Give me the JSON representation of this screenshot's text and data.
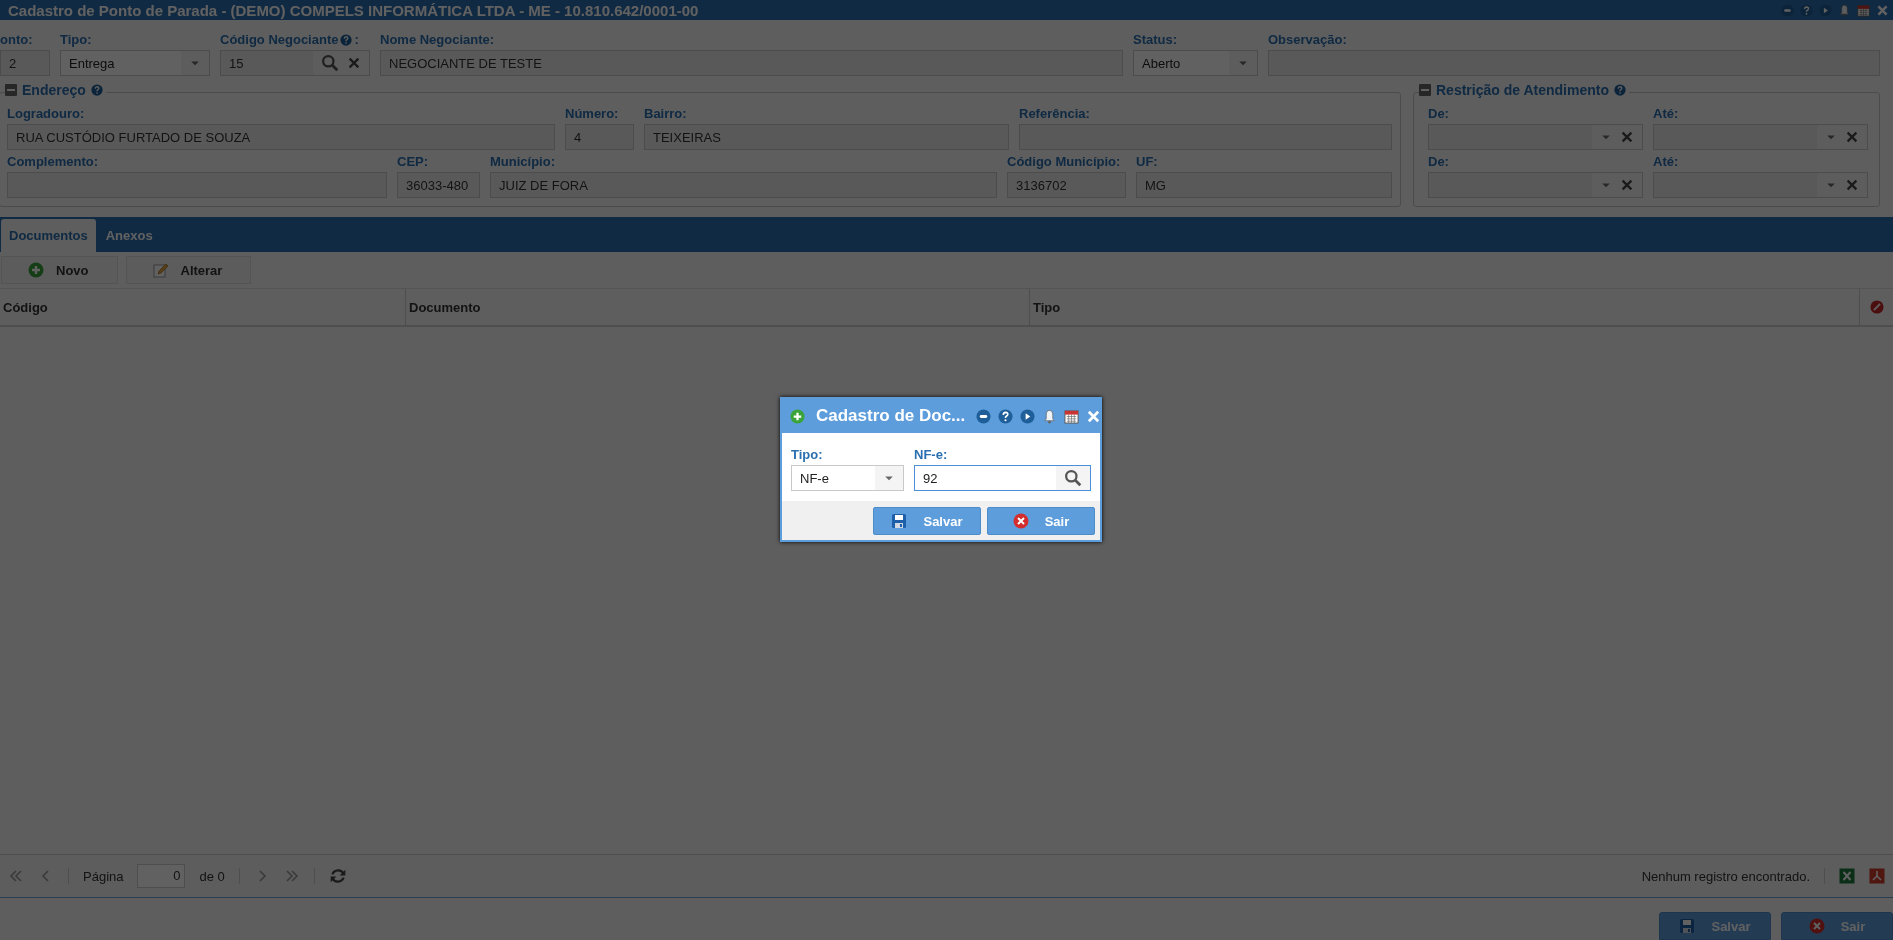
{
  "window": {
    "title": "Cadastro de Ponto de Parada - (DEMO) COMPELS INFORMÁTICA LTDA - ME - 10.810.642/0001-00"
  },
  "header_fields": [
    {
      "label": "onto:",
      "value": "2",
      "kind": "text"
    },
    {
      "label": "Tipo:",
      "value": "Entrega",
      "kind": "select"
    },
    {
      "label": "Código Negociante",
      "help": true,
      "label_end": ":",
      "value": "15",
      "kind": "lookup"
    },
    {
      "label": "Nome Negociante:",
      "value": "NEGOCIANTE DE TESTE",
      "kind": "text"
    },
    {
      "label": "Status:",
      "value": "Aberto",
      "kind": "select"
    },
    {
      "label": "Observação:",
      "kind": "text"
    }
  ],
  "endereco": {
    "title": "Endereço",
    "help": true,
    "rows": [
      [
        {
          "label": "Logradouro:",
          "value": "RUA CUSTÓDIO FURTADO DE SOUZA",
          "kind": "text"
        },
        {
          "label": "Número:",
          "value": "4",
          "kind": "text"
        },
        {
          "label": "Bairro:",
          "value": "TEIXEIRAS",
          "kind": "text"
        },
        {
          "label": "Referência:",
          "kind": "text"
        }
      ],
      [
        {
          "label": "Complemento:",
          "kind": "text"
        },
        {
          "label": "CEP:",
          "value": "36033-480",
          "kind": "text"
        },
        {
          "label": "Município:",
          "value": "JUIZ DE FORA",
          "kind": "text"
        },
        {
          "label": "Código Município:",
          "value": "3136702",
          "kind": "text"
        },
        {
          "label": "UF:",
          "value": "MG",
          "kind": "text"
        }
      ]
    ]
  },
  "restricao": {
    "title": "Restrição de Atendimento",
    "help": true,
    "rows": [
      [
        {
          "label": "De:",
          "kind": "combo"
        },
        {
          "label": "Até:",
          "kind": "combo"
        }
      ],
      [
        {
          "label": "De:",
          "kind": "combo"
        },
        {
          "label": "Até:",
          "kind": "combo"
        }
      ]
    ]
  },
  "tabs": [
    {
      "label": "Documentos",
      "selected": true
    },
    {
      "label": "Anexos",
      "selected": false
    }
  ],
  "toolbar": [
    {
      "label": "Novo",
      "kind": "add"
    },
    {
      "label": "Alterar",
      "kind": "edit"
    }
  ],
  "table": {
    "columns": [
      "Código",
      "Documento",
      "Tipo"
    ]
  },
  "pager": {
    "page_label": "Página",
    "page": "0",
    "of": "de 0",
    "status": "Nenhum registro encontrado."
  },
  "footer_buttons": [
    {
      "label": "Salvar",
      "kind": "save"
    },
    {
      "label": "Sair",
      "kind": "exit"
    }
  ],
  "dialog": {
    "title": "Cadastro de Doc...",
    "fields": [
      {
        "label": "Tipo:",
        "value": "NF-e",
        "kind": "select",
        "focused": false
      },
      {
        "label": "NF-e:",
        "value": "92",
        "kind": "search",
        "focused": true
      }
    ],
    "buttons": [
      {
        "label": "Salvar",
        "kind": "save"
      },
      {
        "label": "Sair",
        "kind": "exit"
      }
    ]
  }
}
